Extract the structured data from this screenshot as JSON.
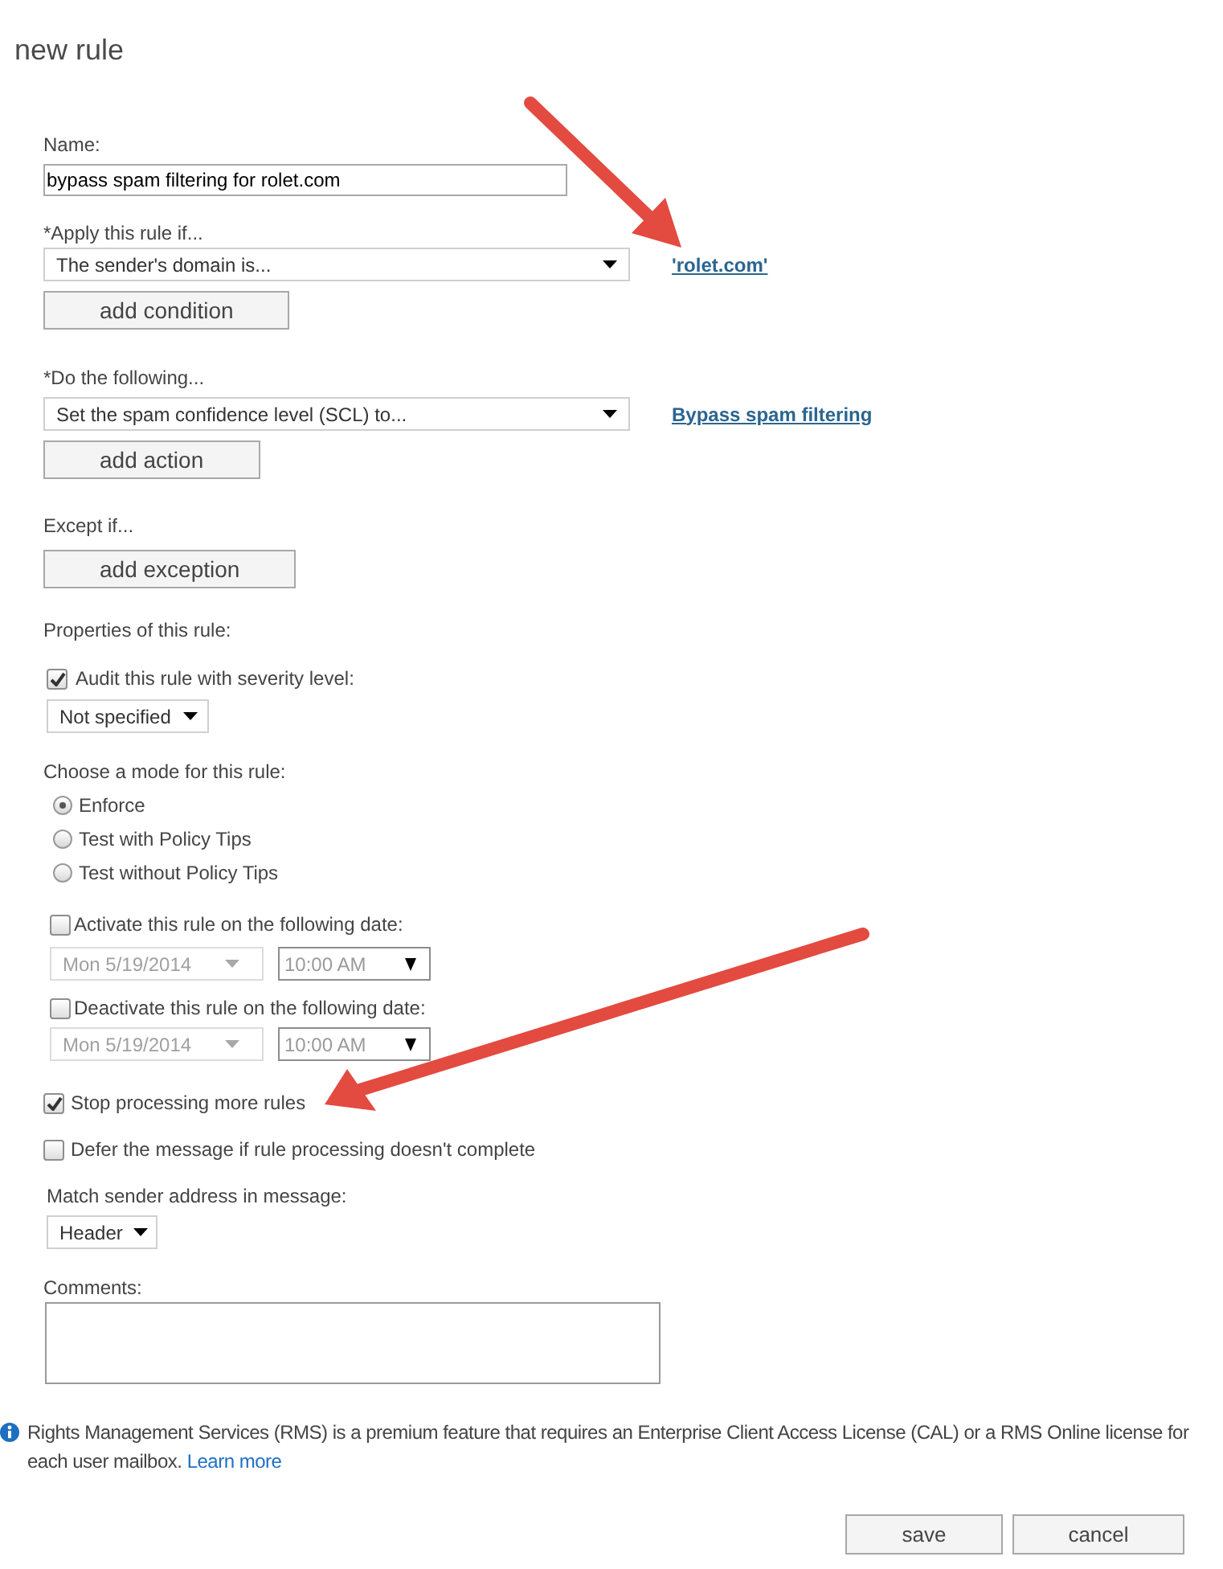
{
  "title": "new rule",
  "name_field": {
    "label": "Name:",
    "value": "bypass spam filtering for rolet.com"
  },
  "condition": {
    "label": "*Apply this rule if...",
    "select": "The sender's domain is...",
    "link": "'rolet.com'",
    "button": "add condition"
  },
  "action": {
    "label": "*Do the following...",
    "select": "Set the spam confidence level (SCL) to...",
    "link": "Bypass spam filtering",
    "button": "add action"
  },
  "exception": {
    "label": "Except if...",
    "button": "add exception"
  },
  "properties": {
    "heading": "Properties of this rule:",
    "audit": {
      "label": "Audit this rule with severity level:",
      "checked": true,
      "severity": "Not specified"
    }
  },
  "mode": {
    "heading": "Choose a mode for this rule:",
    "options": [
      {
        "label": "Enforce",
        "selected": true
      },
      {
        "label": "Test with Policy Tips",
        "selected": false
      },
      {
        "label": "Test without Policy Tips",
        "selected": false
      }
    ]
  },
  "schedule": [
    {
      "label": "Activate this rule on the following date:",
      "checked": false,
      "date": "Mon 5/19/2014",
      "time": "10:00 AM"
    },
    {
      "label": "Deactivate this rule on the following date:",
      "checked": false,
      "date": "Mon 5/19/2014",
      "time": "10:00 AM"
    }
  ],
  "options": [
    {
      "label": "Stop processing more rules",
      "checked": true
    },
    {
      "label": "Defer the message if rule processing doesn't complete",
      "checked": false
    }
  ],
  "match_sender": {
    "label": "Match sender address in message:",
    "value": "Header"
  },
  "comments": {
    "label": "Comments:"
  },
  "notice": {
    "text": "Rights Management Services (RMS) is a premium feature that requires an Enterprise Client Access License (CAL) or a RMS Online license for each user mailbox.",
    "link": "Learn more"
  },
  "buttons": [
    "save",
    "cancel"
  ]
}
